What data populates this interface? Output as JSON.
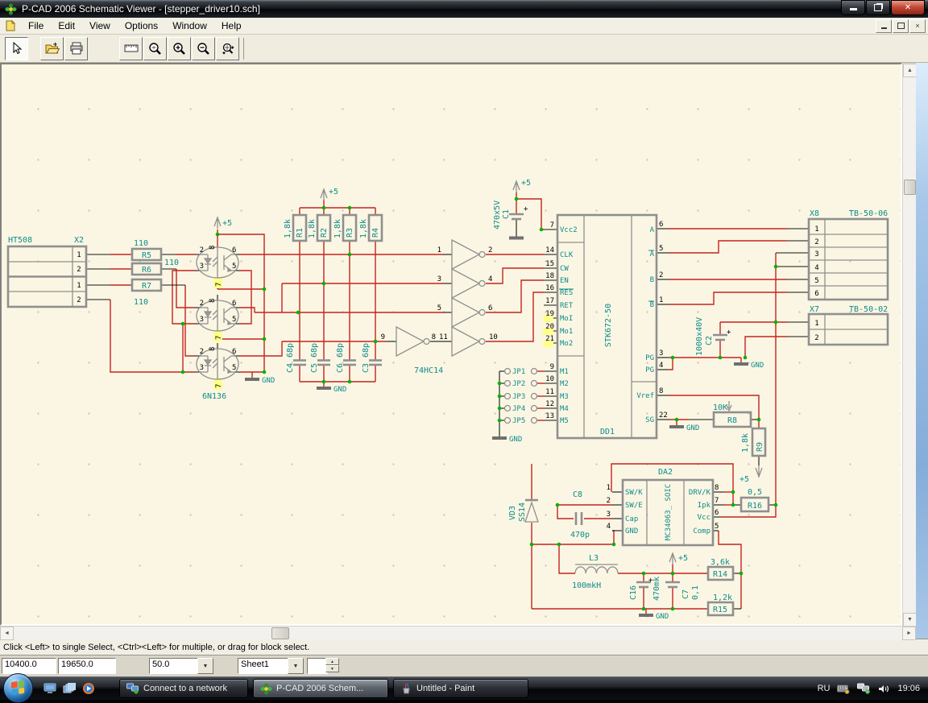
{
  "window": {
    "title": "P-CAD 2006 Schematic Viewer - [stepper_driver10.sch]"
  },
  "menu": {
    "items": [
      "File",
      "Edit",
      "View",
      "Options",
      "Window",
      "Help"
    ]
  },
  "statusbar": {
    "hint": "Click <Left> to single Select, <Ctrl><Left> for multiple, or drag for block select."
  },
  "controls": {
    "coord_x": "10400.0",
    "coord_y": "19650.0",
    "zoom": "50.0",
    "sheet": "Sheet1"
  },
  "taskbar": {
    "tasks": [
      {
        "label": "Connect to a network"
      },
      {
        "label": "P-CAD 2006 Schem..."
      },
      {
        "label": "Untitled - Paint"
      }
    ],
    "lang": "RU",
    "time": "19:06"
  },
  "sch": {
    "plus5": "+5",
    "gnd": "GND",
    "x2": {
      "ref": "X2",
      "type": "HT508",
      "pins": [
        "1",
        "2",
        "1",
        "2"
      ]
    },
    "r5": {
      "ref": "R5",
      "val": "110"
    },
    "r6": {
      "ref": "R6",
      "val": "110"
    },
    "r7": {
      "ref": "R7",
      "val": "110"
    },
    "opto": {
      "part": "6N136",
      "t": "8",
      "b": "7",
      "lt": "2",
      "lb": "3",
      "rt": "6",
      "rb": "5"
    },
    "r1": {
      "ref": "R1",
      "val": "1,8k"
    },
    "r2": {
      "ref": "R2",
      "val": "1,8k"
    },
    "r3": {
      "ref": "R3",
      "val": "1,8k"
    },
    "r4": {
      "ref": "R4",
      "val": "1,8k"
    },
    "c4": {
      "ref": "C4",
      "val": "68p"
    },
    "c5": {
      "ref": "C5",
      "val": "68p"
    },
    "c6": {
      "ref": "C6",
      "val": "68p"
    },
    "c3": {
      "ref": "C3",
      "val": "68p"
    },
    "inv": {
      "part": "74HC14",
      "ins": [
        "1",
        "3",
        "5",
        "11"
      ],
      "outs": [
        "2",
        "4",
        "6",
        "10"
      ],
      "pin": "9",
      "pout": "8"
    },
    "c1": {
      "ref": "C1",
      "val": "470x5V"
    },
    "dd1": {
      "ref": "DD1",
      "part": "STK672-50",
      "ll": [
        "Vcc2",
        "CLK",
        "CW",
        "EN",
        "RES",
        "RET",
        "MoI",
        "Mo1",
        "Mo2"
      ],
      "lp": [
        "7",
        "14",
        "15",
        "18",
        "16",
        "17",
        "19",
        "20",
        "21"
      ],
      "ml": [
        "M1",
        "M2",
        "M3",
        "M4",
        "M5"
      ],
      "mp": [
        "9",
        "10",
        "11",
        "12",
        "13"
      ],
      "rl": [
        "A",
        "A",
        "B",
        "B",
        "PG",
        "PG",
        "Vref",
        "SG"
      ],
      "rp": [
        "6",
        "5",
        "2",
        "1",
        "3",
        "4",
        "8",
        "22"
      ]
    },
    "jp": [
      "JP1",
      "JP2",
      "JP3",
      "JP4",
      "JP5"
    ],
    "x8": {
      "ref": "X8",
      "type": "TB-50-06",
      "pins": [
        "1",
        "2",
        "3",
        "4",
        "5",
        "6"
      ]
    },
    "x7": {
      "ref": "X7",
      "type": "TB-50-02",
      "pins": [
        "1",
        "2"
      ]
    },
    "c2": {
      "ref": "C2",
      "val": "1000x40V"
    },
    "r8": {
      "ref": "R8",
      "val": "10K"
    },
    "r9": {
      "ref": "R9",
      "val": "1,8k"
    },
    "r16": {
      "ref": "R16",
      "val": "0,5"
    },
    "da2": {
      "ref": "DA2",
      "part": "MC34063_ SOIC",
      "ll": [
        "SW/K",
        "SW/E",
        "Cap",
        "GND"
      ],
      "lp": [
        "1",
        "2",
        "3",
        "4"
      ],
      "rl": [
        "DRV/K",
        "Ipk",
        "Vcc",
        "Comp"
      ],
      "rp": [
        "8",
        "7",
        "6",
        "5"
      ]
    },
    "vd3": {
      "ref": "VD3",
      "part": "SS14"
    },
    "c8": {
      "ref": "C8",
      "val": "470p"
    },
    "l3": {
      "ref": "L3",
      "val": "100mkH"
    },
    "c16": {
      "ref": "C16",
      "val": "470mk"
    },
    "c7": {
      "ref": "C7",
      "val": "0,1"
    },
    "r14": {
      "ref": "R14",
      "val": "3,6k"
    },
    "r15": {
      "ref": "R15",
      "val": "1,2k"
    }
  }
}
